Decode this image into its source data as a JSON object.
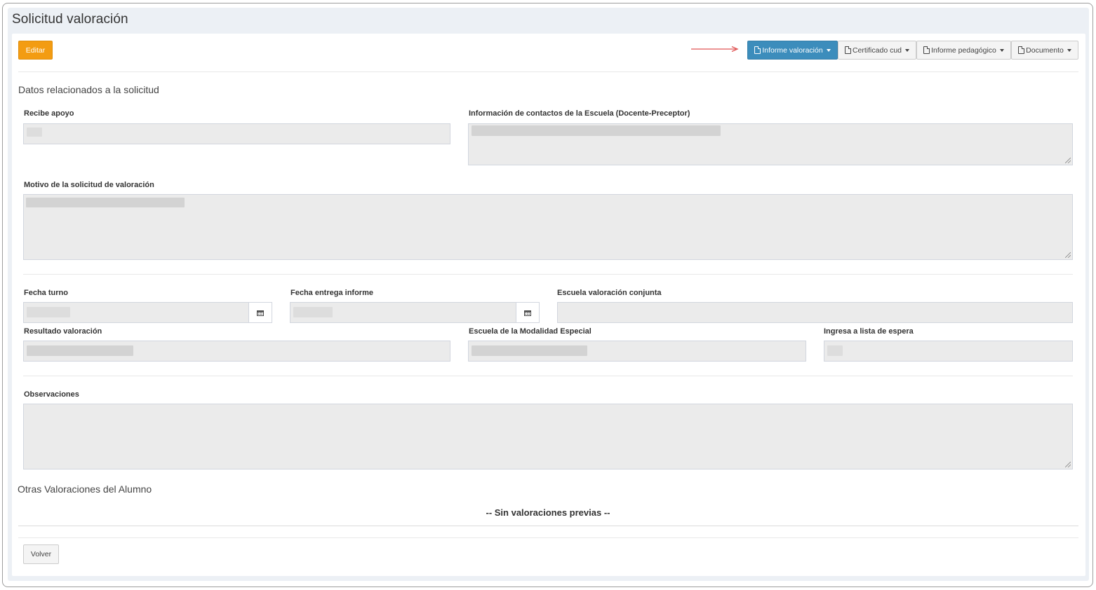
{
  "page": {
    "title": "Solicitud valoración"
  },
  "toolbar": {
    "edit_label": "Editar",
    "buttons": [
      {
        "label": "Informe valoración",
        "icon": "file-icon",
        "active": true
      },
      {
        "label": "Certificado cud",
        "icon": "file-icon",
        "active": false
      },
      {
        "label": "Informe pedagógico",
        "icon": "file-icon",
        "active": false
      },
      {
        "label": "Documento",
        "icon": "file-icon",
        "active": false
      }
    ],
    "arrow_color": "#e05555"
  },
  "section_request": {
    "title": "Datos relacionados a la solicitud",
    "recibe_apoyo_label": "Recibe apoyo",
    "contactos_label": "Información de contactos de la Escuela (Docente-Preceptor)",
    "motivo_label": "Motivo de la solicitud de valoración"
  },
  "section_dates": {
    "fecha_turno_label": "Fecha turno",
    "fecha_entrega_label": "Fecha entrega informe",
    "escuela_conjunta_label": "Escuela valoración conjunta",
    "resultado_label": "Resultado valoración",
    "escuela_modalidad_label": "Escuela de la Modalidad Especial",
    "lista_espera_label": "Ingresa a lista de espera"
  },
  "section_obs": {
    "label": "Observaciones"
  },
  "section_other": {
    "title": "Otras Valoraciones del Alumno",
    "empty_message": "-- Sin valoraciones previas --"
  },
  "footer": {
    "back_label": "Volver"
  },
  "colors": {
    "primary": "#3c8dbc",
    "warning": "#f39c12",
    "field_bg": "#ebebeb"
  }
}
